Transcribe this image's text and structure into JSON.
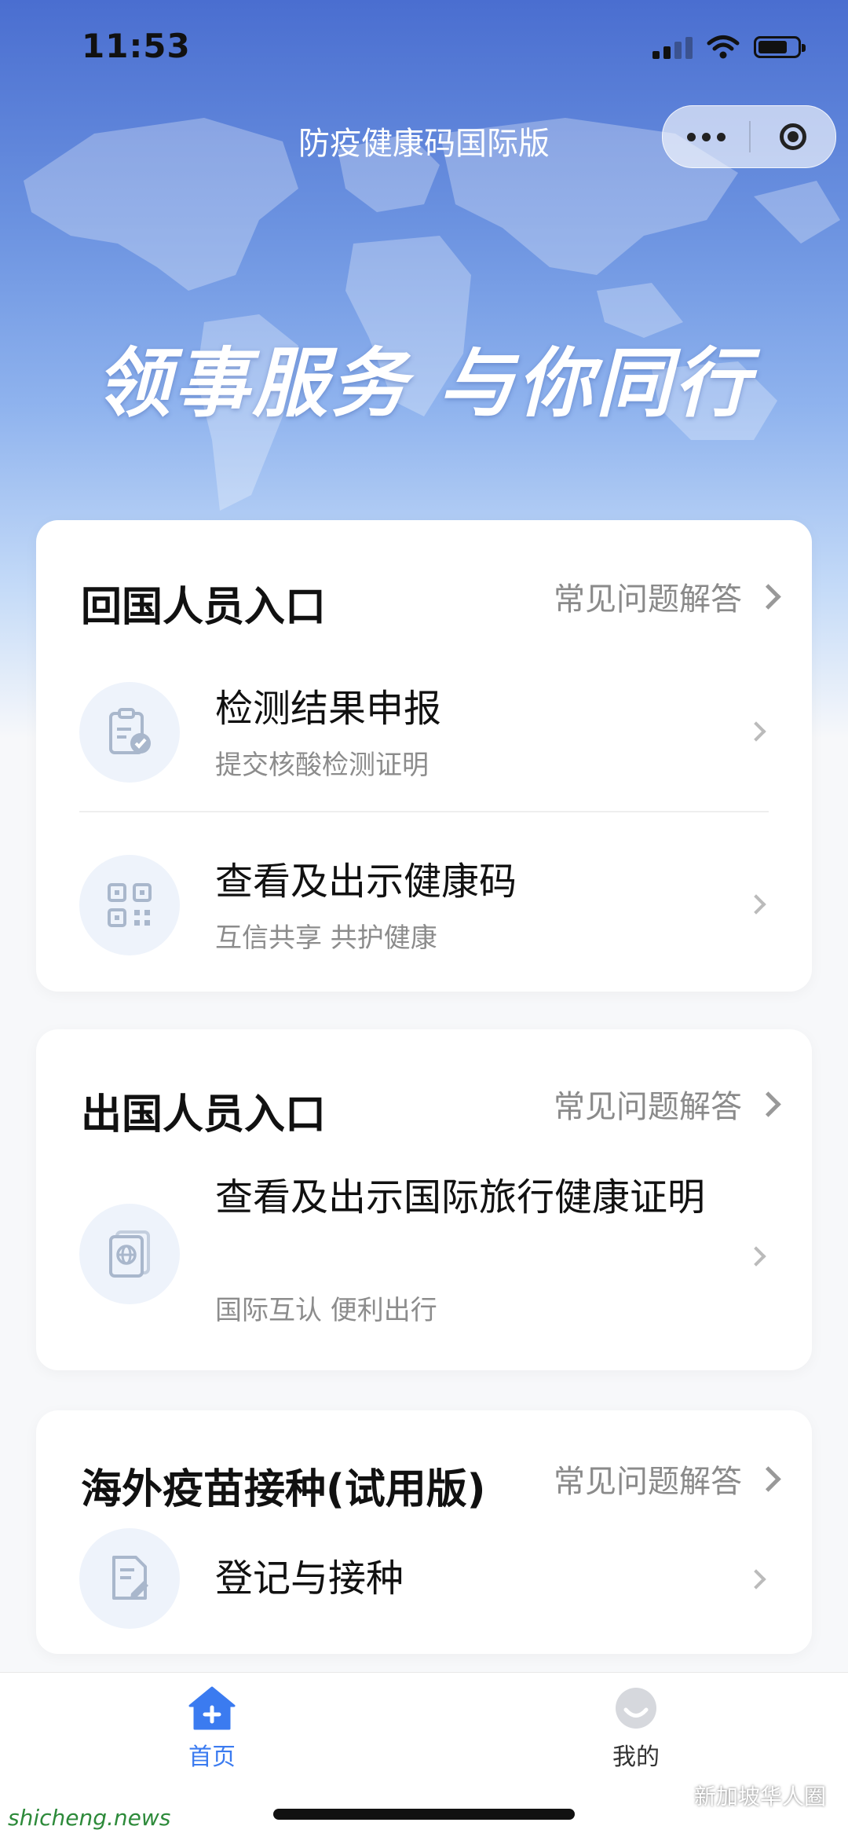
{
  "status_bar": {
    "time": "11:53"
  },
  "nav": {
    "title": "防疫健康码国际版"
  },
  "hero": {
    "slogan": "领事服务 与你同行"
  },
  "sections": [
    {
      "title": "回国人员入口",
      "faq": "常见问题解答",
      "items": [
        {
          "title": "检测结果申报",
          "subtitle": "提交核酸检测证明",
          "icon": "clipboard-check-icon"
        },
        {
          "title": "查看及出示健康码",
          "subtitle": "互信共享 共护健康",
          "icon": "qr-code-icon"
        }
      ]
    },
    {
      "title": "出国人员入口",
      "faq": "常见问题解答",
      "items": [
        {
          "title": "查看及出示国际旅行健康证明",
          "subtitle": "国际互认 便利出行",
          "icon": "passport-icon"
        }
      ]
    },
    {
      "title": "海外疫苗接种(试用版)",
      "faq": "常见问题解答",
      "items": [
        {
          "title": "登记与接种",
          "subtitle": "",
          "icon": "document-pen-icon"
        }
      ]
    }
  ],
  "tabbar": {
    "items": [
      {
        "label": "首页",
        "icon": "home-icon",
        "active": true
      },
      {
        "label": "我的",
        "icon": "profile-icon",
        "active": false
      }
    ]
  },
  "colors": {
    "accent": "#3b7bf0",
    "icon_bg": "#eef3fb",
    "icon_fg": "#9fb0c9"
  },
  "watermarks": {
    "right": "新加坡华人圈",
    "left": "shicheng.news"
  }
}
